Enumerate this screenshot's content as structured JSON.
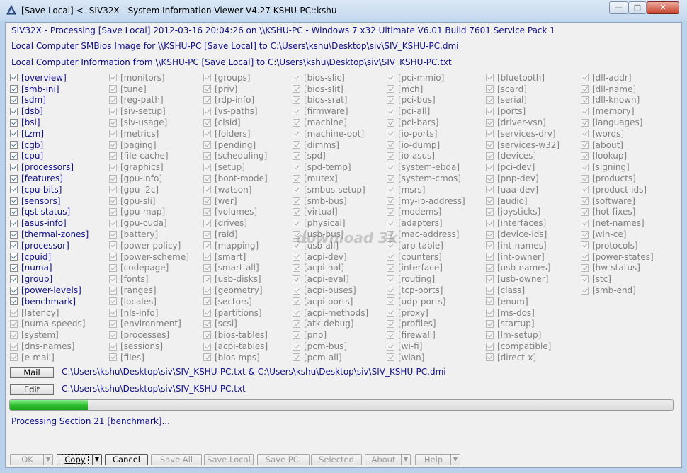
{
  "window": {
    "title": "[Save Local] <- SIV32X - System Information Viewer V4.27 KSHU-PC::kshu",
    "min_glyph": "—",
    "max_glyph": "□",
    "close_glyph": "✕"
  },
  "info": {
    "line1": "SIV32X - Processing [Save Local] 2012-03-16 20:04:26 on \\\\KSHU-PC - Windows 7 x32 Ultimate  V6.01  Build 7601  Service Pack 1",
    "line2": "Local Computer SMBios Image for \\\\KSHU-PC [Save Local] to C:\\Users\\kshu\\Desktop\\siv\\SIV_KSHU-PC.dmi",
    "line3": "Local Computer Information from \\\\KSHU-PC [Save Local] to C:\\Users\\kshu\\Desktop\\siv\\SIV_KSHU-PC.txt"
  },
  "columns": [
    {
      "enabled": true,
      "items": [
        "[overview]",
        "[smb-ini]",
        "[sdm]",
        "[dsb]",
        "[bsi]",
        "[tzm]",
        "[cgb]",
        "[cpu]",
        "[processors]",
        "[features]",
        "[cpu-bits]",
        "[sensors]",
        "[qst-status]",
        "[asus-info]",
        "[thermal-zones]",
        "[processor]",
        "[cpuid]",
        "[numa]",
        "[group]",
        "[power-levels]",
        "[benchmark]",
        "[latency]",
        "[numa-speeds]",
        "[system]",
        "[dns-names]",
        "[e-mail]"
      ],
      "checked": [
        true,
        true,
        true,
        true,
        true,
        true,
        true,
        true,
        true,
        true,
        true,
        true,
        true,
        true,
        true,
        true,
        true,
        true,
        true,
        true,
        true,
        false,
        false,
        false,
        false,
        false
      ]
    },
    {
      "enabled": false,
      "items": [
        "[monitors]",
        "[tune]",
        "[reg-path]",
        "[siv-setup]",
        "[siv-usage]",
        "[metrics]",
        "[paging]",
        "[file-cache]",
        "[graphics]",
        "[gpu-info]",
        "[gpu-i2c]",
        "[gpu-sli]",
        "[gpu-map]",
        "[gpu-cuda]",
        "[battery]",
        "[power-policy]",
        "[power-scheme]",
        "[codepage]",
        "[fonts]",
        "[ranges]",
        "[locales]",
        "[nls-info]",
        "[environment]",
        "[processes]",
        "[sessions]",
        "[files]"
      ]
    },
    {
      "enabled": false,
      "items": [
        "[groups]",
        "[priv]",
        "[rdp-info]",
        "[vs-paths]",
        "[clsid]",
        "[folders]",
        "[pending]",
        "[scheduling]",
        "[setup]",
        "[boot-mode]",
        "[watson]",
        "[wer]",
        "[volumes]",
        "[drives]",
        "[raid]",
        "[mapping]",
        "[smart]",
        "[smart-all]",
        "[usb-disks]",
        "[geometry]",
        "[sectors]",
        "[partitions]",
        "[scsi]",
        "[bios-tables]",
        "[acpi-tables]",
        "[bios-mps]"
      ]
    },
    {
      "enabled": false,
      "items": [
        "[bios-slic]",
        "[bios-slit]",
        "[bios-srat]",
        "[firmware]",
        "[machine]",
        "[machine-opt]",
        "[dimms]",
        "[spd]",
        "[spd-temp]",
        "[mutex]",
        "[smbus-setup]",
        "[smb-bus]",
        "[virtual]",
        "[physical]",
        "[usb-bus]",
        "[usb-all]",
        "[acpi-dev]",
        "[acpi-hal]",
        "[acpi-eval]",
        "[acpi-buses]",
        "[acpi-ports]",
        "[acpi-methods]",
        "[atk-debug]",
        "[pnp]",
        "[pcm-bus]",
        "[pcm-all]"
      ]
    },
    {
      "enabled": false,
      "items": [
        "[pci-mmio]",
        "[mch]",
        "[pci-bus]",
        "[pci-all]",
        "[pci-bars]",
        "[io-ports]",
        "[io-dump]",
        "[io-asus]",
        "[system-ebda]",
        "[system-cmos]",
        "[msrs]",
        "[my-ip-address]",
        "[modems]",
        "[adapters]",
        "[mac-address]",
        "[arp-table]",
        "[counters]",
        "[interface]",
        "[routing]",
        "[tcp-ports]",
        "[udp-ports]",
        "[proxy]",
        "[profiles]",
        "[firewall]",
        "[wi-fi]",
        "[wlan]"
      ]
    },
    {
      "enabled": false,
      "items": [
        "[bluetooth]",
        "[scard]",
        "[serial]",
        "[ports]",
        "[driver-vsn]",
        "[services-drv]",
        "[services-w32]",
        "[devices]",
        "[pci-dev]",
        "[pnp-dev]",
        "[uaa-dev]",
        "[audio]",
        "[joysticks]",
        "[interfaces]",
        "[device-ids]",
        "[int-names]",
        "[int-owner]",
        "[usb-names]",
        "[usb-owner]",
        "[class]",
        "[enum]",
        "[ms-dos]",
        "[startup]",
        "[lm-setup]",
        "[compatible]",
        "[direct-x]"
      ]
    },
    {
      "enabled": false,
      "items": [
        "[dll-addr]",
        "[dll-name]",
        "[dll-known]",
        "[memory]",
        "[languages]",
        "[words]",
        "[about]",
        "[lookup]",
        "[signing]",
        "[products]",
        "[product-ids]",
        "[software]",
        "[hot-fixes]",
        "[net-names]",
        "[win-ce]",
        "[protocols]",
        "[power-states]",
        "[hw-status]",
        "[stc]",
        "[smb-end]"
      ]
    }
  ],
  "mail": {
    "label": "Mail",
    "path": "C:\\Users\\kshu\\Desktop\\siv\\SIV_KSHU-PC.txt & C:\\Users\\kshu\\Desktop\\siv\\SIV_KSHU-PC.dmi"
  },
  "edit": {
    "label": "Edit",
    "path": "C:\\Users\\kshu\\Desktop\\siv\\SIV_KSHU-PC.txt"
  },
  "progress": {
    "fraction": 0.118
  },
  "status": "Processing Section 21 [benchmark]...",
  "watermark": "download 3k",
  "buttons": {
    "ok": "OK",
    "copy": "Copy",
    "cancel": "Cancel",
    "save_all": "Save All",
    "save_local": "Save Local",
    "save_pci": "Save PCI",
    "selected": "Selected",
    "about": "About",
    "help": "Help",
    "arrow": "▼"
  }
}
